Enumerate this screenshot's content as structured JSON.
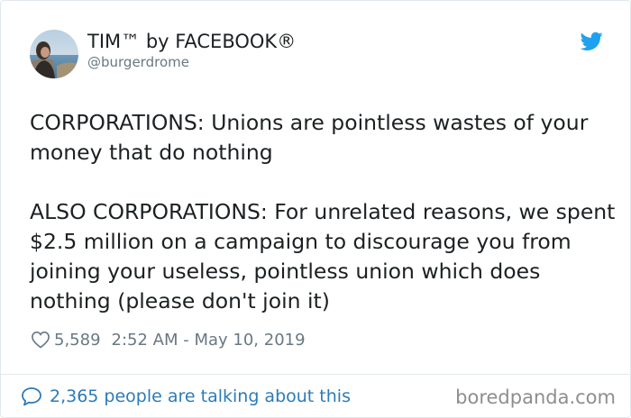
{
  "tweet": {
    "display_name": "TIM™ by FACEBOOK®",
    "handle": "@burgerdrome",
    "text_paragraph_1": "CORPORATIONS: Unions are pointless wastes of your money that do nothing",
    "text_paragraph_2": "ALSO CORPORATIONS: For unrelated reasons, we spent $2.5 million on a campaign to discourage you from joining your useless, pointless union which does nothing (please don't join it)",
    "like_count": "5,589",
    "timestamp": "2:52 AM - May 10, 2019",
    "talking_link": "2,365 people are talking about this"
  },
  "icons": {
    "avatar": "avatar-photo",
    "brand": "twitter-bird-icon",
    "like": "heart-icon",
    "reply": "speech-bubble-icon"
  },
  "watermark": "boredpanda.com",
  "colors": {
    "twitter_blue": "#1da1f2",
    "link_blue": "#2b7bb9",
    "muted_gray": "#697882",
    "text_dark": "#1c2022",
    "border": "#e1e8ed"
  }
}
